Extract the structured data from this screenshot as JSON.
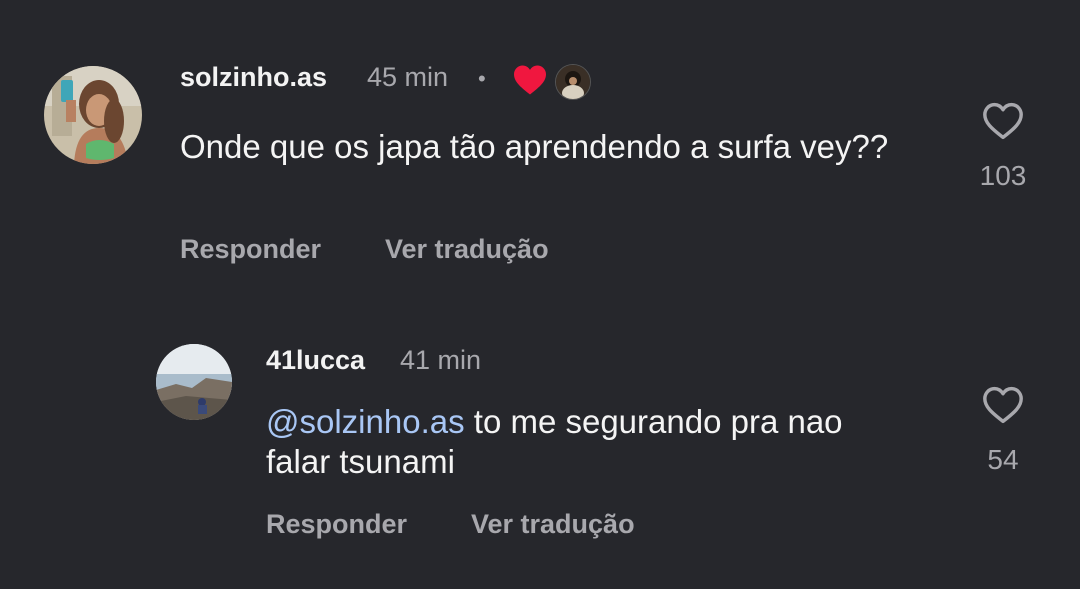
{
  "comments": [
    {
      "username": "solzinho.as",
      "time": "45 min",
      "separator": "•",
      "text": "Onde que os japa tão aprendendo a surfa vey??",
      "reply_label": "Responder",
      "translate_label": "Ver tradução",
      "likes": "103",
      "author_liked": true
    },
    {
      "username": "41lucca",
      "time": "41 min",
      "mention": "@solzinho.as",
      "text": " to me segurando pra nao falar tsunami",
      "reply_label": "Responder",
      "translate_label": "Ver tradução",
      "likes": "54"
    }
  ],
  "colors": {
    "background": "#26272c",
    "mention": "#a9c7f5",
    "heart_red": "#f0173f",
    "muted": "#a8a8ad"
  },
  "icons": [
    "heart-outline-icon",
    "heart-filled-icon",
    "creator-avatar-icon"
  ]
}
